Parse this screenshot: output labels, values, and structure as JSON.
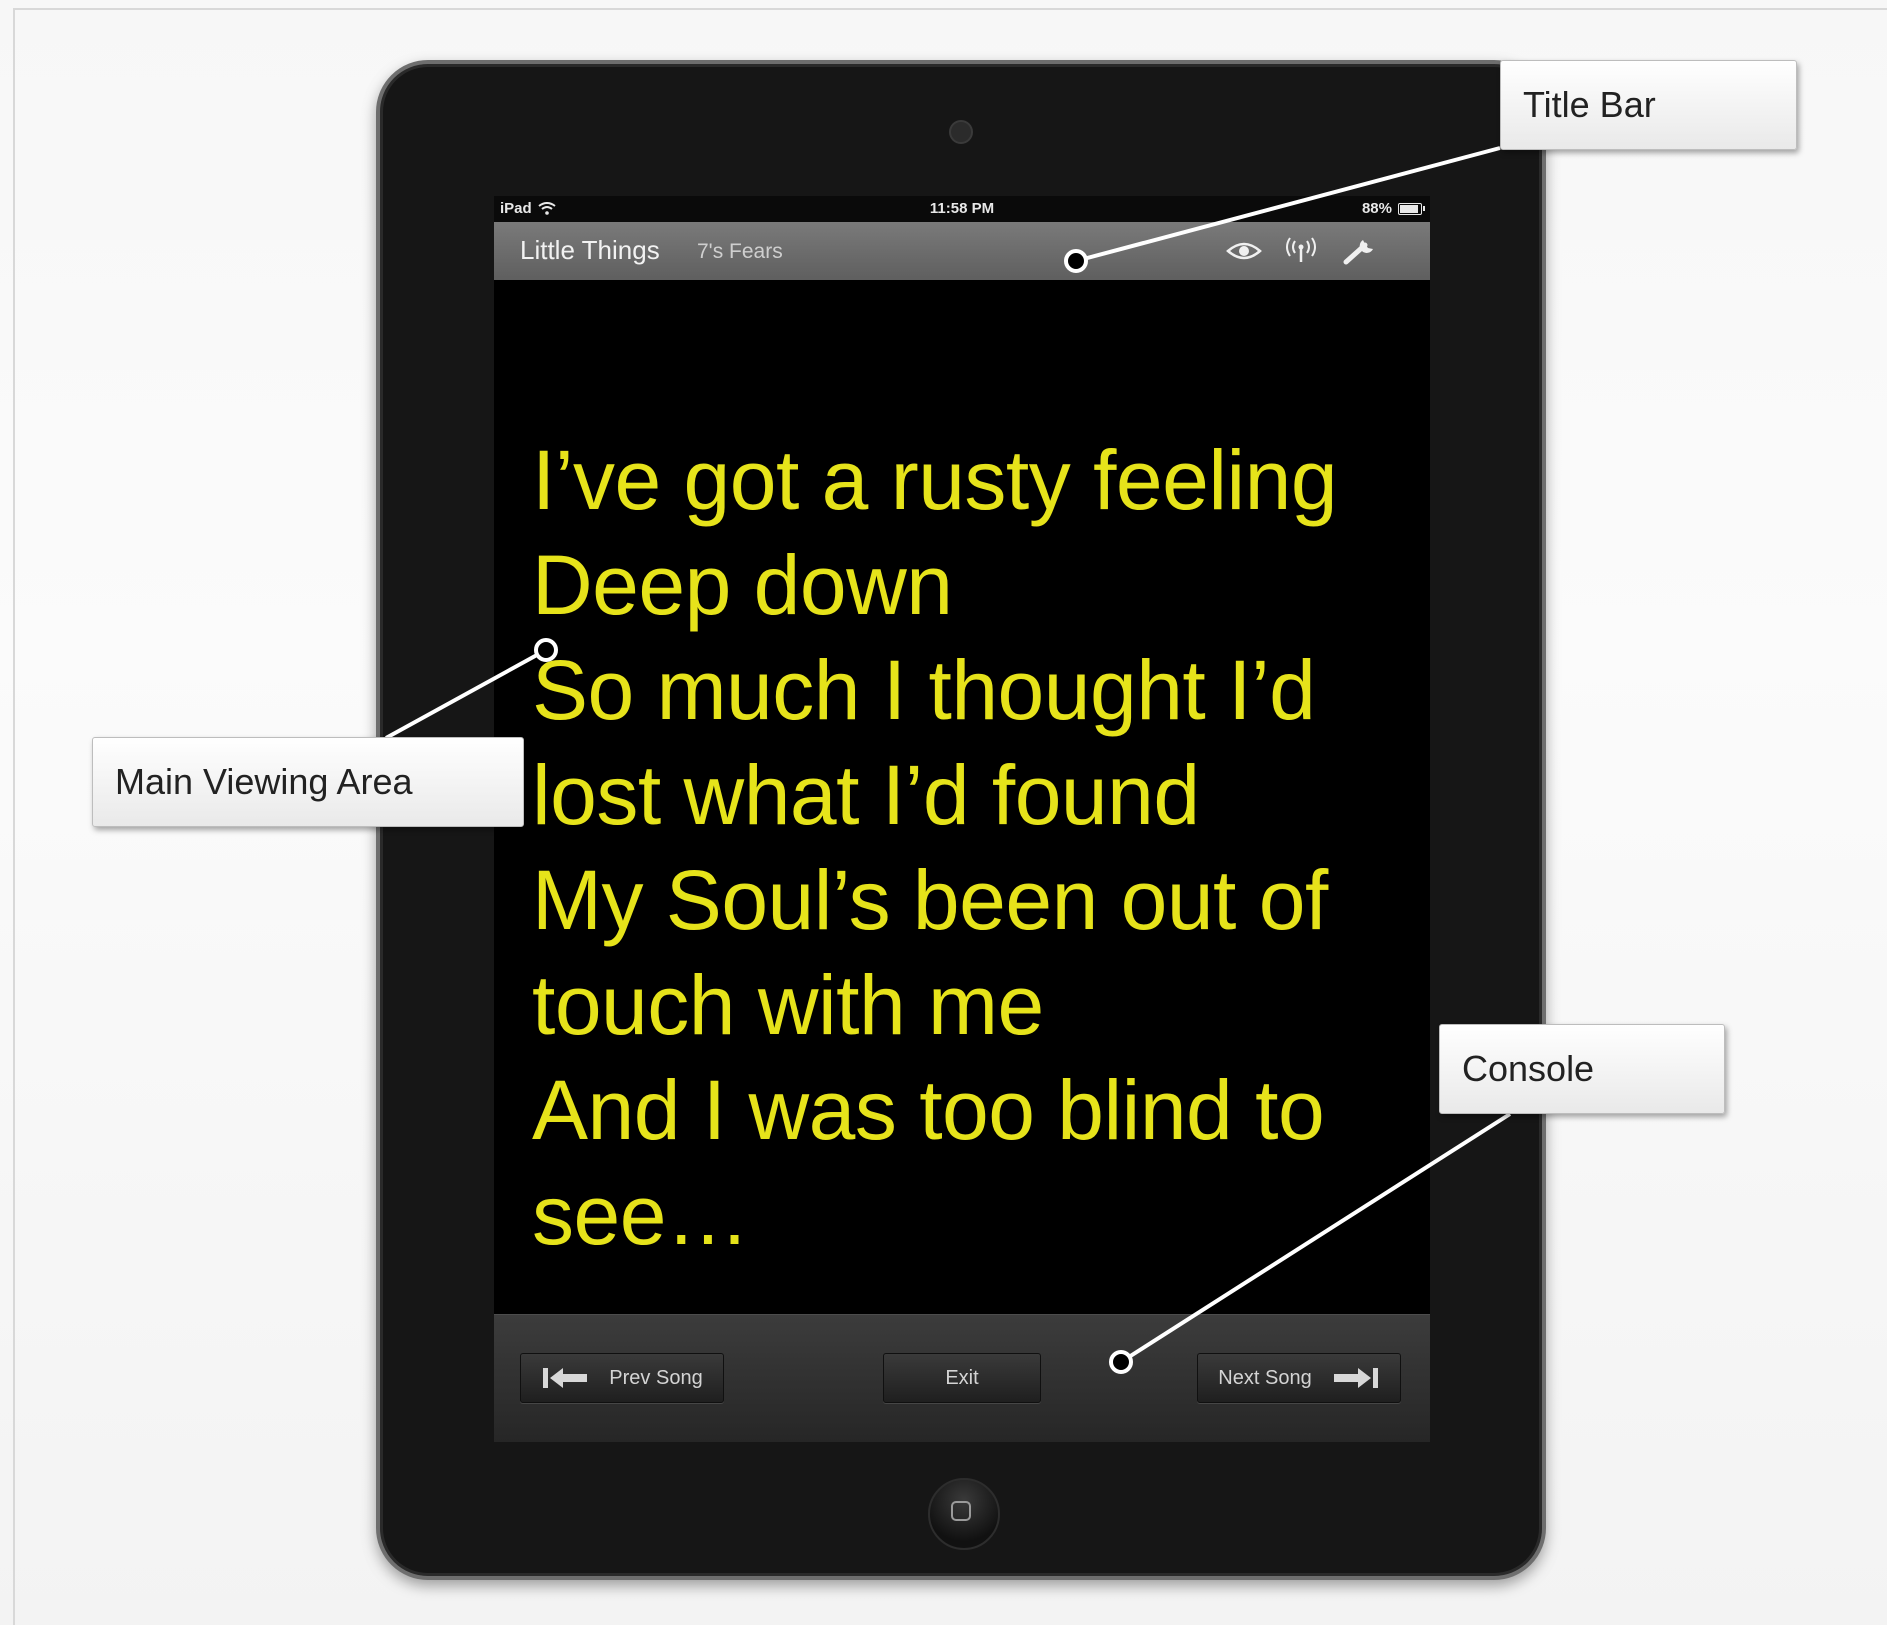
{
  "status_bar": {
    "device": "iPad",
    "time": "11:58 PM",
    "battery": "88%"
  },
  "title_bar": {
    "song_title": "Little Things",
    "artist": "7's Fears",
    "icons": [
      "eye-icon",
      "broadcast-icon",
      "wrench-icon"
    ]
  },
  "lyrics": [
    "I’ve got a rusty feeling",
    "Deep down",
    "So much I thought I’d",
    "lost what I’d found",
    "My Soul’s been out of",
    "touch with me",
    "And I was too blind to",
    "see…"
  ],
  "console": {
    "prev_label": "Prev Song",
    "exit_label": "Exit",
    "next_label": "Next Song"
  },
  "callouts": {
    "title_bar": "Title Bar",
    "main_viewing_area": "Main Viewing Area",
    "console": "Console"
  },
  "colors": {
    "lyrics": "#e6e31a",
    "screen_bg": "#000000",
    "title_bar": "#6a6a6a"
  }
}
